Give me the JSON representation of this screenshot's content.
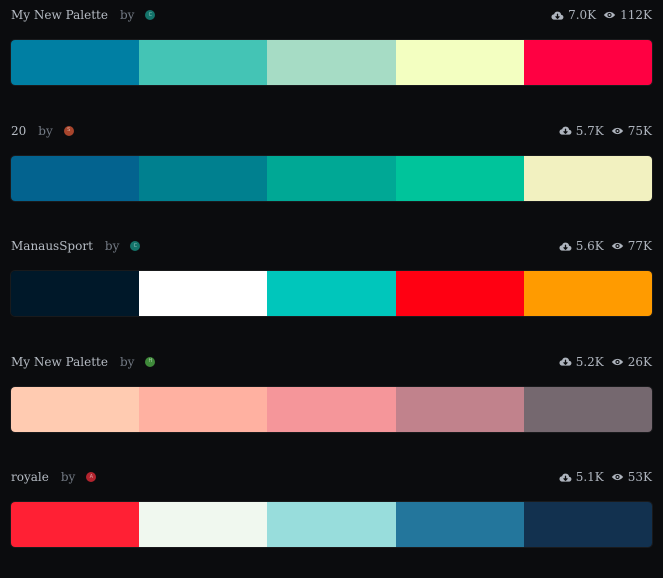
{
  "palettes": [
    {
      "name": "My New Palette",
      "by_label": "by",
      "avatar": {
        "letter": "C",
        "color": "#14746a"
      },
      "downloads": "7.0K",
      "views": "112K",
      "colors": [
        "#007fa3",
        "#44c4b5",
        "#a6dcc5",
        "#f3ffc1",
        "#ff0042"
      ]
    },
    {
      "name": "20",
      "by_label": "by",
      "avatar": {
        "letter": "S",
        "color": "#a8452c"
      },
      "downloads": "5.7K",
      "views": "75K",
      "colors": [
        "#03638f",
        "#00808f",
        "#00a895",
        "#00c49b",
        "#f2f1c0"
      ]
    },
    {
      "name": "ManausSport",
      "by_label": "by",
      "avatar": {
        "letter": "C",
        "color": "#14746a"
      },
      "downloads": "5.6K",
      "views": "77K",
      "colors": [
        "#001829",
        "#ffffff",
        "#00c6bb",
        "#ff0012",
        "#ff9b00"
      ]
    },
    {
      "name": "My New Palette",
      "by_label": "by",
      "avatar": {
        "letter": "H",
        "color": "#3f8a3a"
      },
      "downloads": "5.2K",
      "views": "26K",
      "colors": [
        "#ffcbb1",
        "#ffb1a1",
        "#f5969a",
        "#c1828c",
        "#75686f"
      ]
    },
    {
      "name": "royale",
      "by_label": "by",
      "avatar": {
        "letter": "A",
        "color": "#b3242e"
      },
      "downloads": "5.1K",
      "views": "53K",
      "colors": [
        "#ff2034",
        "#f0f8ef",
        "#98dddc",
        "#23769c",
        "#12314f"
      ]
    }
  ],
  "icons": {
    "downloads": "cloud-download-icon",
    "views": "eye-icon"
  }
}
